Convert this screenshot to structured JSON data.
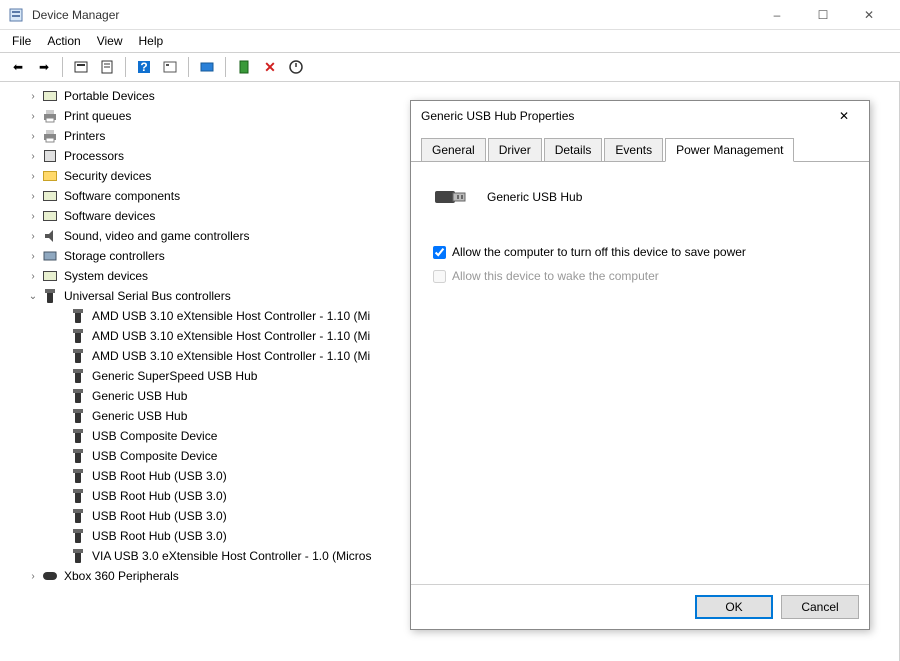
{
  "window": {
    "title": "Device Manager",
    "controls": {
      "min": "–",
      "max": "☐",
      "close": "✕"
    }
  },
  "menu": [
    "File",
    "Action",
    "View",
    "Help"
  ],
  "toolbar": {
    "back": "←",
    "forward": "→"
  },
  "tree": {
    "categories": [
      {
        "icon": "device",
        "label": "Portable Devices"
      },
      {
        "icon": "printer",
        "label": "Print queues"
      },
      {
        "icon": "printer",
        "label": "Printers"
      },
      {
        "icon": "cpu",
        "label": "Processors"
      },
      {
        "icon": "folder",
        "label": "Security devices"
      },
      {
        "icon": "device",
        "label": "Software components"
      },
      {
        "icon": "device",
        "label": "Software devices"
      },
      {
        "icon": "sound",
        "label": "Sound, video and game controllers"
      },
      {
        "icon": "storage",
        "label": "Storage controllers"
      },
      {
        "icon": "device",
        "label": "System devices"
      }
    ],
    "usb_category": {
      "icon": "usb",
      "label": "Universal Serial Bus controllers"
    },
    "usb_children": [
      "AMD USB 3.10 eXtensible Host Controller - 1.10 (Mi",
      "AMD USB 3.10 eXtensible Host Controller - 1.10 (Mi",
      "AMD USB 3.10 eXtensible Host Controller - 1.10 (Mi",
      "Generic SuperSpeed USB Hub",
      "Generic USB Hub",
      "Generic USB Hub",
      "USB Composite Device",
      "USB Composite Device",
      "USB Root Hub (USB 3.0)",
      "USB Root Hub (USB 3.0)",
      "USB Root Hub (USB 3.0)",
      "USB Root Hub (USB 3.0)",
      "VIA USB 3.0 eXtensible Host Controller - 1.0 (Micros"
    ],
    "footer_category": {
      "icon": "controller",
      "label": "Xbox 360 Peripherals"
    }
  },
  "dialog": {
    "title": "Generic USB Hub Properties",
    "close": "✕",
    "tabs": [
      "General",
      "Driver",
      "Details",
      "Events",
      "Power Management"
    ],
    "active_tab": 4,
    "device_name": "Generic USB Hub",
    "check1_label": "Allow the computer to turn off this device to save power",
    "check1_checked": true,
    "check2_label": "Allow this device to wake the computer",
    "check2_checked": false,
    "ok": "OK",
    "cancel": "Cancel"
  }
}
